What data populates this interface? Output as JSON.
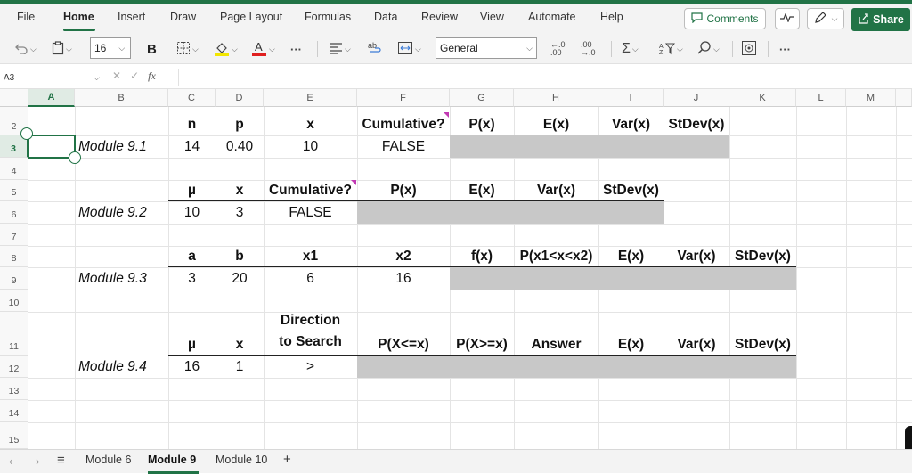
{
  "menu": {
    "items": [
      {
        "label": "File",
        "active": false
      },
      {
        "label": "Home",
        "active": true
      },
      {
        "label": "Insert",
        "active": false
      },
      {
        "label": "Draw",
        "active": false
      },
      {
        "label": "Page Layout",
        "active": false
      },
      {
        "label": "Formulas",
        "active": false
      },
      {
        "label": "Data",
        "active": false
      },
      {
        "label": "Review",
        "active": false
      },
      {
        "label": "View",
        "active": false
      },
      {
        "label": "Automate",
        "active": false
      },
      {
        "label": "Help",
        "active": false
      }
    ],
    "comments_label": "Comments",
    "share_label": "Share"
  },
  "ribbon": {
    "font_size": "16",
    "bold_label": "B",
    "number_format": "General",
    "more_label": "···",
    "inc_decimal": "←.0 .00",
    "dec_decimal": ".00 →.0"
  },
  "formula_bar": {
    "name_box": "A3",
    "fx_label": "fx",
    "formula": ""
  },
  "grid": {
    "columns": [
      "A",
      "B",
      "C",
      "D",
      "E",
      "F",
      "G",
      "H",
      "I",
      "J",
      "K",
      "L",
      "M"
    ],
    "selected_column": "A",
    "rows": [
      "2",
      "3",
      "4",
      "5",
      "6",
      "7",
      "8",
      "9",
      "10",
      "11",
      "12",
      "13",
      "14",
      "15"
    ],
    "selected_row": "3",
    "selected_cell": "A3",
    "cells": {
      "r2": {
        "C": "n",
        "D": "p",
        "E": "x",
        "F": "Cumulative?",
        "G": "P(x)",
        "H": "E(x)",
        "I": "Var(x)",
        "J": "StDev(x)"
      },
      "r3": {
        "B": "Module 9.1",
        "C": "14",
        "D": "0.40",
        "E": "10",
        "F": "FALSE"
      },
      "r5": {
        "C": "µ",
        "D": "x",
        "E": "Cumulative?",
        "F": "P(x)",
        "G": "E(x)",
        "H": "Var(x)",
        "I": "StDev(x)"
      },
      "r6": {
        "B": "Module 9.2",
        "C": "10",
        "D": "3",
        "E": "FALSE"
      },
      "r8": {
        "C": "a",
        "D": "b",
        "E": "x1",
        "F": "x2",
        "G": "f(x)",
        "H": "P(x1<x<x2)",
        "I": "E(x)",
        "J": "Var(x)",
        "K": "StDev(x)"
      },
      "r9": {
        "B": "Module 9.3",
        "C": "3",
        "D": "20",
        "E": "6",
        "F": "16"
      },
      "r11": {
        "C": "µ",
        "D": "x",
        "E_line1": "Direction",
        "E_line2": "to Search",
        "F": "P(X<=x)",
        "G": "P(X>=x)",
        "H": "Answer",
        "I": "E(x)",
        "J": "Var(x)",
        "K": "StDev(x)"
      },
      "r12": {
        "B": "Module 9.4",
        "C": "16",
        "D": "1",
        "E": ">"
      }
    }
  },
  "sheet_tabs": {
    "tabs": [
      {
        "label": "Module 6",
        "active": false
      },
      {
        "label": "Module 9",
        "active": true
      },
      {
        "label": "Module 10",
        "active": false
      }
    ],
    "add_label": "+"
  },
  "colors": {
    "accent": "#217346",
    "output_fill": "#c8c8c8",
    "comment_flag": "#c239b3"
  }
}
